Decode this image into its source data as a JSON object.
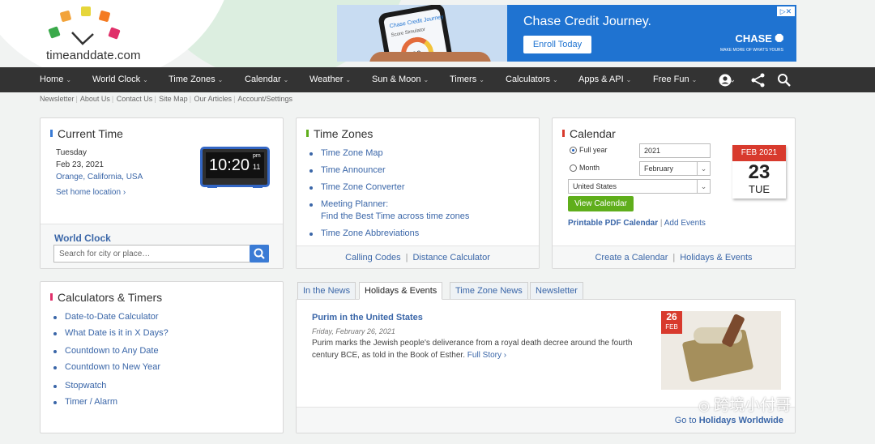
{
  "logo": {
    "text": "timeanddate.com"
  },
  "ad": {
    "phone_title": "Chase Credit Journey",
    "phone_subtitle": "Score Simulator",
    "phone_score": "720",
    "headline": "Chase Credit Journey.",
    "button": "Enroll Today",
    "brand": "CHASE",
    "tagline": "MAKE MORE OF WHAT'S YOURS"
  },
  "nav": {
    "items": [
      "Home",
      "World Clock",
      "Time Zones",
      "Calendar",
      "Weather",
      "Sun & Moon",
      "Timers",
      "Calculators",
      "Apps & API",
      "Free Fun"
    ],
    "icons": [
      "user-icon",
      "share-icon",
      "search-icon"
    ]
  },
  "subnav": [
    "Newsletter",
    "About Us",
    "Contact Us",
    "Site Map",
    "Our Articles",
    "Account/Settings"
  ],
  "current_time": {
    "title": "Current Time",
    "day": "Tuesday",
    "date": "Feb 23, 2021",
    "location": "Orange, California, USA",
    "set_home": "Set home location",
    "clock_time": "10:20",
    "clock_ampm": "pm",
    "clock_seconds": "11",
    "world_clock_title": "World Clock",
    "search_placeholder": "Search for city or place…"
  },
  "time_zones": {
    "title": "Time Zones",
    "items": [
      "Time Zone Map",
      "Time Announcer",
      "Time Zone Converter",
      "Meeting Planner:",
      "Time Zone Abbreviations"
    ],
    "meeting_sub": "Find the Best Time across time zones",
    "footer": [
      "Calling Codes",
      "Distance Calculator"
    ]
  },
  "calendar": {
    "title": "Calendar",
    "full_year_label": "Full year",
    "year_value": "2021",
    "month_label": "Month",
    "month_value": "February",
    "country_value": "United States",
    "view_button": "View Calendar",
    "pdf_link": "Printable PDF Calendar",
    "add_events": "Add Events",
    "icon_month": "FEB",
    "icon_year": "2021",
    "icon_day": "23",
    "icon_weekday": "TUE",
    "footer": [
      "Create a Calendar",
      "Holidays & Events"
    ]
  },
  "calculators": {
    "title": "Calculators & Timers",
    "items": [
      "Date-to-Date Calculator",
      "What Date is it in X Days?",
      "Countdown to Any Date",
      "Countdown to New Year",
      "Stopwatch",
      "Timer / Alarm"
    ]
  },
  "news": {
    "tabs": [
      "In the News",
      "Holidays & Events",
      "Time Zone News",
      "Newsletter"
    ],
    "article_title": "Purim in the United States",
    "article_date": "Friday, February 26, 2021",
    "article_body_1": "Purim marks the Jewish people's deliverance from a royal death decree around the fourth",
    "article_body_2": "century BCE, as told in the Book of Esther.",
    "full_story": "Full Story",
    "badge_day": "26",
    "badge_month": "FEB",
    "footer_prefix": "Go to",
    "footer_link": "Holidays Worldwide"
  },
  "watermark": "跨境小付哥",
  "colors": {
    "nav_bg": "#333333",
    "link": "#3a66a8",
    "bar_blue": "#3a7bd5",
    "bar_green": "#5fae1b",
    "bar_red": "#d83a2d",
    "bar_pink": "#e0306a",
    "ad_blue": "#1f73d1"
  }
}
